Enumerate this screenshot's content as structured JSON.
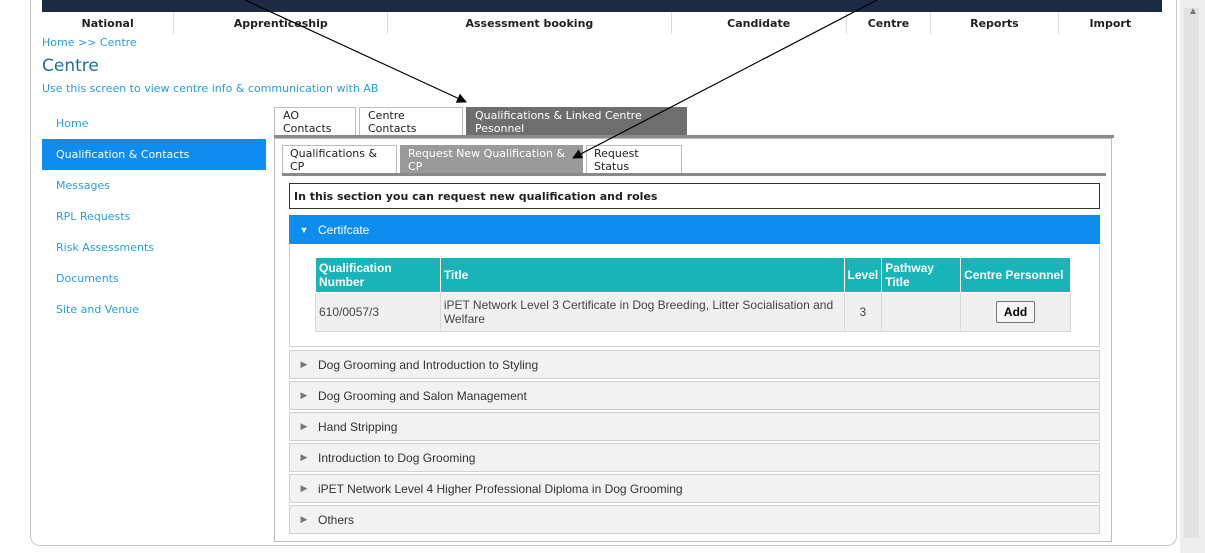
{
  "top_nav": [
    "National",
    "Apprenticeship",
    "Assessment booking",
    "Candidate",
    "Centre",
    "Reports",
    "Import"
  ],
  "breadcrumb": "Home >> Centre",
  "page_title": "Centre",
  "subtitle": "Use this screen to view centre info & communication with AB",
  "sidebar": {
    "items": [
      {
        "label": "Home"
      },
      {
        "label": "Qualification & Contacts"
      },
      {
        "label": "Messages"
      },
      {
        "label": "RPL Requests"
      },
      {
        "label": "Risk Assessments"
      },
      {
        "label": "Documents"
      },
      {
        "label": "Site and Venue"
      }
    ]
  },
  "main_tabs": [
    {
      "label": "AO Contacts"
    },
    {
      "label": "Centre Contacts"
    },
    {
      "label": "Qualifications & Linked Centre Pesonnel"
    }
  ],
  "sub_tabs": [
    {
      "label": "Qualifications & CP"
    },
    {
      "label": "Request New Qualification & CP"
    },
    {
      "label": "Request Status"
    }
  ],
  "info_text": "In this section you can request new qualification and roles",
  "accordion": [
    {
      "label": "Certifcate"
    },
    {
      "label": "Dog Grooming and Introduction to Styling"
    },
    {
      "label": "Dog Grooming and Salon Management"
    },
    {
      "label": "Hand Stripping"
    },
    {
      "label": "Introduction to Dog Grooming"
    },
    {
      "label": "iPET Network Level 4 Higher Professional Diploma in Dog Grooming"
    },
    {
      "label": "Others"
    }
  ],
  "table": {
    "headers": [
      "Qualification Number",
      "Title",
      "Level",
      "Pathway Title",
      "Centre Personnel"
    ],
    "rows": [
      {
        "number": "610/0057/3",
        "title": "iPET Network Level 3 Certificate in Dog Breeding, Litter Socialisation and Welfare",
        "level": "3",
        "pathway": "",
        "action": "Add"
      }
    ]
  },
  "colors": {
    "accent_blue": "#0d8df0",
    "table_header_teal": "#19b4b8",
    "link_blue": "#2a9fd6",
    "title_blue": "#1e6f9a",
    "active_tab_gray": "#6e6e6e"
  }
}
